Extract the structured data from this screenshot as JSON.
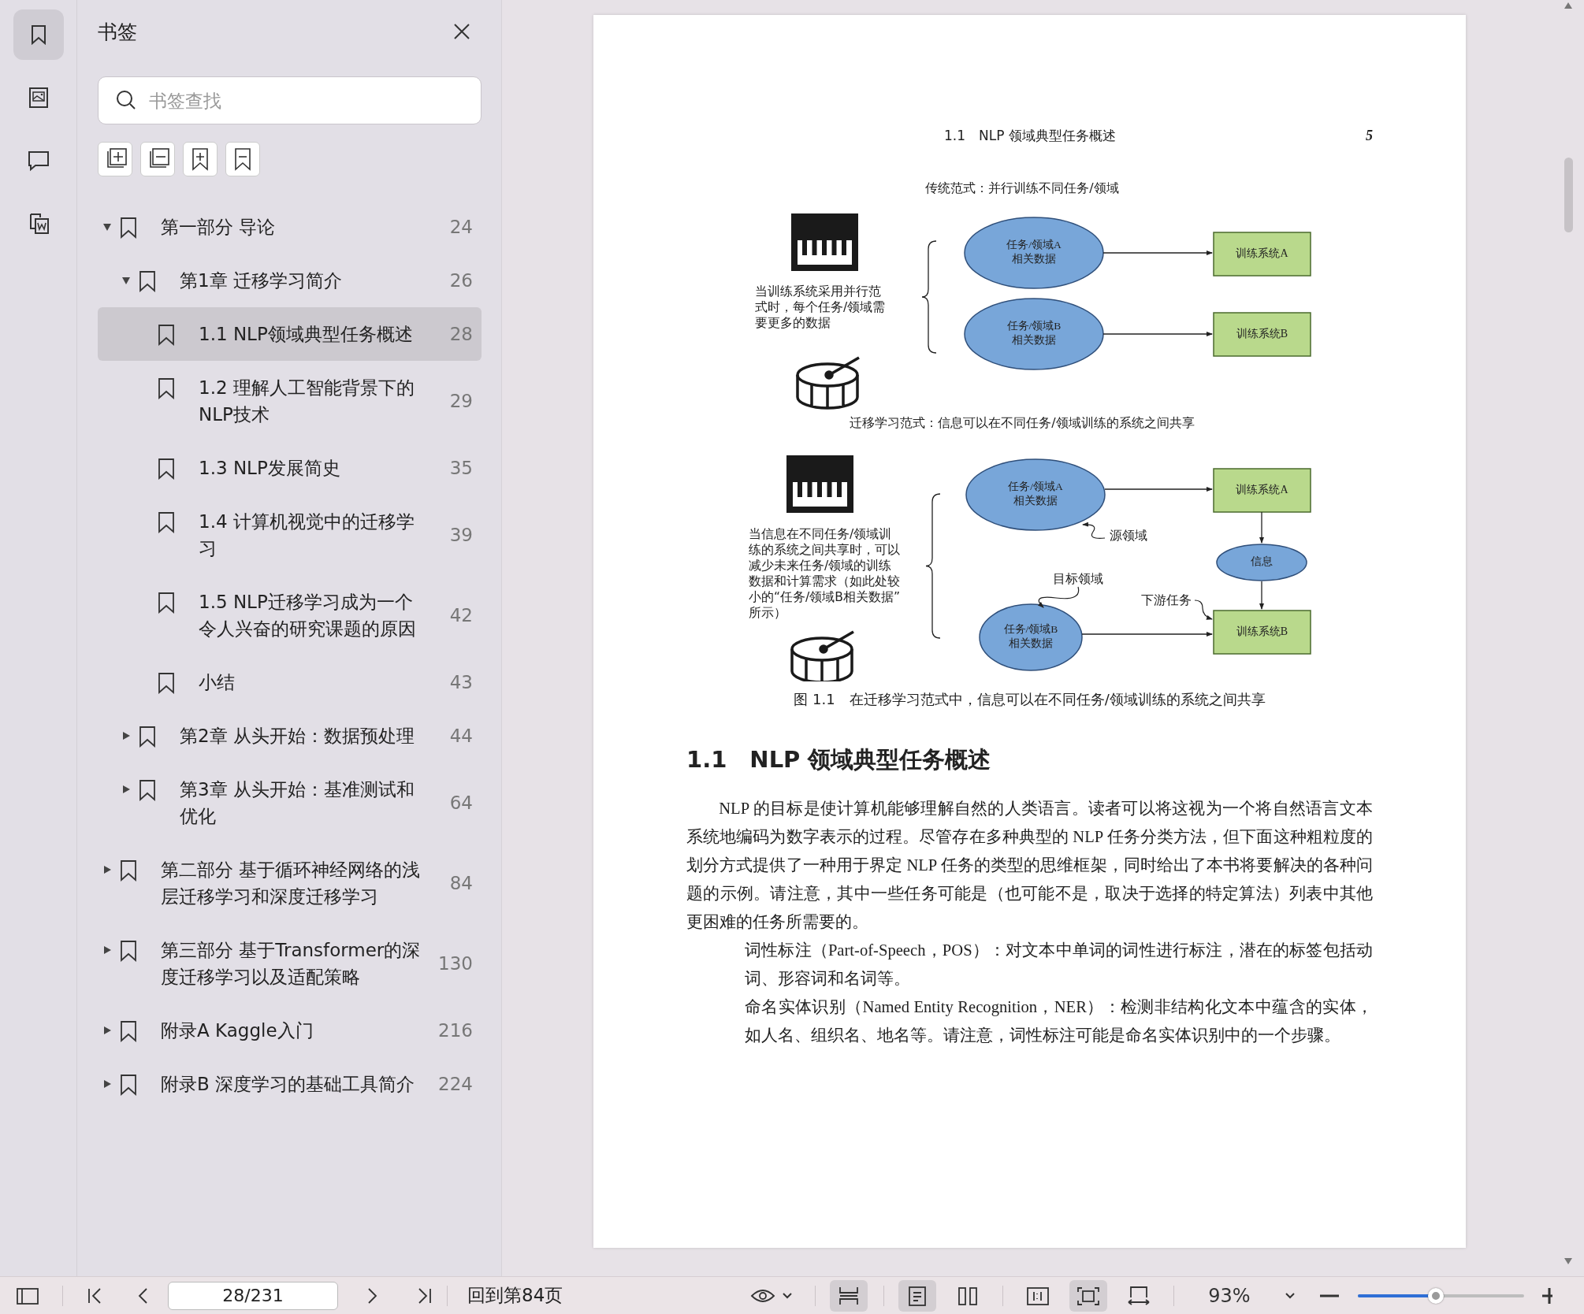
{
  "rail": [
    {
      "kind": "bookmarks",
      "selected": true
    },
    {
      "kind": "thumbnails",
      "selected": false
    },
    {
      "kind": "comments",
      "selected": false
    },
    {
      "kind": "documents",
      "selected": false
    }
  ],
  "sidebar": {
    "title": "书签",
    "search": {
      "placeholder": "书签查找"
    },
    "bookmarks": [
      {
        "title": "第一部分  导论",
        "page": "24",
        "expanded": true,
        "selected": false,
        "children": [
          {
            "title": "第1章  迁移学习简介",
            "page": "26",
            "expanded": true,
            "selected": false,
            "children": [
              {
                "title": "1.1 NLP领域典型任务概述",
                "page": "28",
                "selected": true
              },
              {
                "title": "1.2 理解人工智能背景下的NLP技术",
                "page": "29",
                "selected": false
              },
              {
                "title": "1.3 NLP发展简史",
                "page": "35",
                "selected": false
              },
              {
                "title": "1.4 计算机视觉中的迁移学习",
                "page": "39",
                "selected": false
              },
              {
                "title": "1.5 NLP迁移学习成为一个令人兴奋的研究课题的原因",
                "page": "42",
                "selected": false
              },
              {
                "title": "小结",
                "page": "43",
                "selected": false
              }
            ]
          },
          {
            "title": "第2章  从头开始：数据预处理",
            "page": "44",
            "expanded": false,
            "selected": false
          },
          {
            "title": "第3章  从头开始：基准测试和优化",
            "page": "64",
            "expanded": false,
            "selected": false
          }
        ]
      },
      {
        "title": "第二部分  基于循环神经网络的浅层迁移学习和深度迁移学习",
        "page": "84",
        "expanded": false,
        "selected": false
      },
      {
        "title": "第三部分  基于Transformer的深度迁移学习以及适配策略",
        "page": "130",
        "expanded": false,
        "selected": false
      },
      {
        "title": "附录A  Kaggle入门",
        "page": "216",
        "expanded": false,
        "selected": false
      },
      {
        "title": "附录B  深度学习的基础工具简介",
        "page": "224",
        "expanded": false,
        "selected": false
      }
    ]
  },
  "page": {
    "header": "1.1　NLP 领域典型任务概述",
    "page_number": "5",
    "figure": {
      "traditional": {
        "title": "传统范式：并行训练不同任务/领域",
        "note": [
          "当训练系统采用并行范",
          "式时，每个任务/领域需",
          "要更多的数据"
        ],
        "data_nodes": [
          [
            "任务/领域A",
            "相关数据"
          ],
          [
            "任务/领域B",
            "相关数据"
          ]
        ],
        "systems": [
          "训练系统A",
          "训练系统B"
        ]
      },
      "transfer": {
        "title": "迁移学习范式：信息可以在不同任务/领域训练的系统之间共享",
        "note": [
          "当信息在不同任务/领域训",
          "练的系统之间共享时，可以",
          "减少未来任务/领域的训练",
          "数据和计算需求（如此处较",
          "小的“任务/领域B相关数据”",
          "所示）"
        ],
        "source_data": [
          "任务/领域A",
          "相关数据"
        ],
        "target_data": [
          "任务/领域B",
          "相关数据"
        ],
        "system_a": "训练系统A",
        "info": "信息",
        "system_b": "训练系统B",
        "source_label": "源领域",
        "target_label": "目标领域",
        "downstream_label": "下游任务"
      },
      "caption": "图 1.1　在迁移学习范式中，信息可以在不同任务/领域训练的系统之间共享"
    },
    "heading": "1.1　NLP 领域典型任务概述",
    "paragraphs": [
      {
        "kind": "body",
        "text": "NLP 的目标是使计算机能够理解自然的人类语言。读者可以将这视为一个将自然语言文本系统地编码为数字表示的过程。尽管存在多种典型的 NLP 任务分类方法，但下面这种粗粒度的划分方式提供了一种用于界定 NLP 任务的类型的思维框架，同时给出了本书将要解决的各种问题的示例。请注意，其中一些任务可能是（也可能不是，取决于选择的特定算法）列表中其他更困难的任务所需要的。"
      },
      {
        "kind": "item",
        "text": "词性标注（Part-of-Speech，POS）：对文本中单词的词性进行标注，潜在的标签包括动词、形容词和名词等。"
      },
      {
        "kind": "item",
        "text": "命名实体识别（Named Entity Recognition，NER）：检测非结构化文本中蕴含的实体，如人名、组织名、地名等。请注意，词性标注可能是命名实体识别中的一个步骤。"
      }
    ]
  },
  "toolbar": {
    "page_field": {
      "value": "28/231"
    },
    "back_button": "回到第84页",
    "scroll_modes": [
      {
        "kind": "continuous",
        "selected": true
      }
    ],
    "page_modes": [
      {
        "kind": "single",
        "selected": true
      },
      {
        "kind": "two_page",
        "selected": false
      }
    ],
    "zoom_modes": [
      {
        "kind": "actual_size",
        "selected": false
      },
      {
        "kind": "fit_page",
        "selected": true
      },
      {
        "kind": "fit_width",
        "selected": false
      }
    ],
    "zoom": "93%",
    "zoom_slider": {
      "level": 0.47
    }
  }
}
